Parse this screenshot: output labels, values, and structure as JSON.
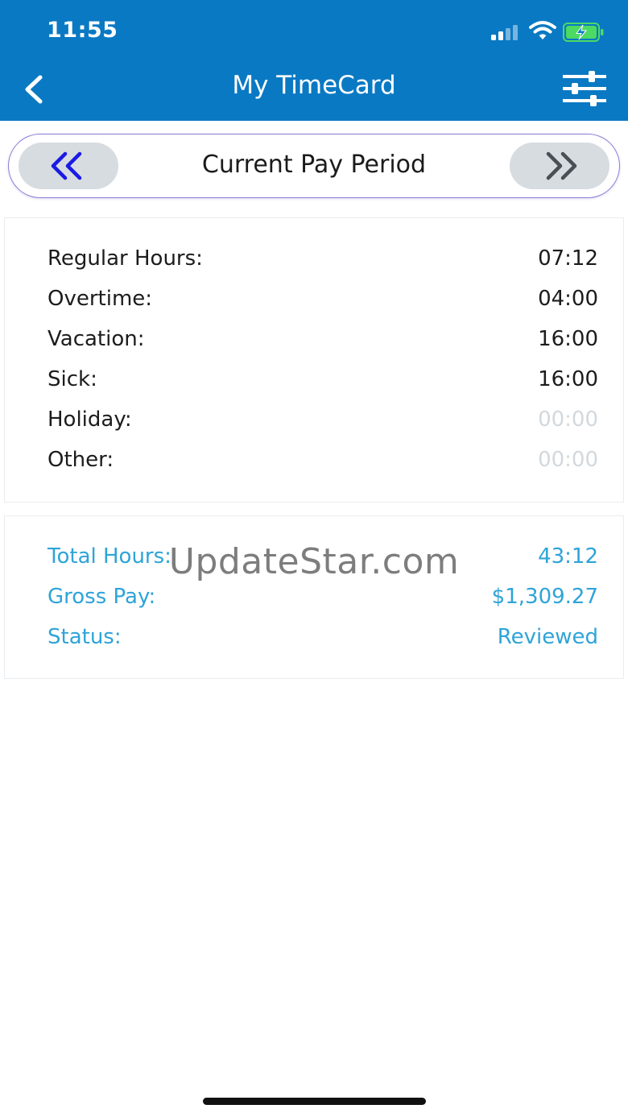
{
  "status_bar": {
    "time": "11:55"
  },
  "nav": {
    "title": "My TimeCard"
  },
  "period": {
    "label": "Current Pay Period"
  },
  "hours": [
    {
      "label": "Regular Hours:",
      "value": "07:12"
    },
    {
      "label": "Overtime:",
      "value": "04:00"
    },
    {
      "label": "Vacation:",
      "value": "16:00"
    },
    {
      "label": "Sick:",
      "value": "16:00"
    },
    {
      "label": "Holiday:",
      "value": "00:00"
    },
    {
      "label": "Other:",
      "value": "00:00"
    }
  ],
  "summary": [
    {
      "label": "Total Hours:",
      "value": "43:12"
    },
    {
      "label": "Gross Pay:",
      "value": "$1,309.27"
    },
    {
      "label": "Status:",
      "value": "Reviewed"
    }
  ],
  "watermark": "UpdateStar.com",
  "colors": {
    "header": "#0a79c3",
    "accent_blue": "#2ea4d8",
    "chevron_blue": "#1a1ae6",
    "muted": "#d3d8dc"
  },
  "icons": [
    "back-chevron-icon",
    "filter-sliders-icon",
    "double-chevron-left-icon",
    "double-chevron-right-icon",
    "cellular-signal-icon",
    "wifi-icon",
    "battery-charging-icon"
  ]
}
